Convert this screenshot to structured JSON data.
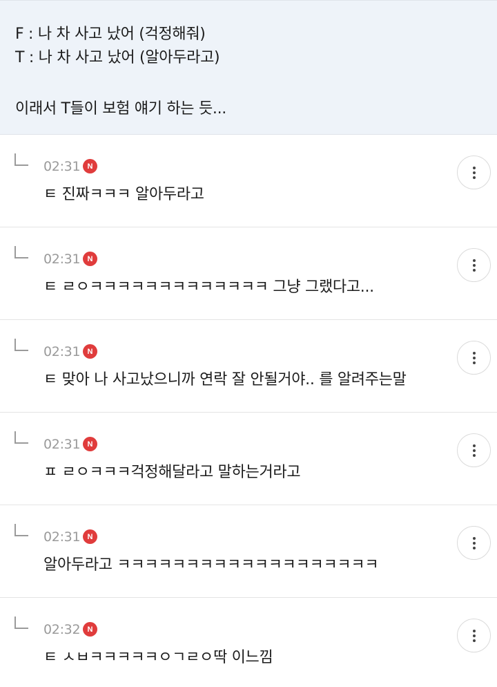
{
  "post": {
    "lines": [
      "F : 나 차 사고 났어 (걱정해줘)",
      "T : 나 차 사고 났어 (알아두라고)",
      "이래서 T들이 보험 얘기 하는 듯..."
    ]
  },
  "comments": [
    {
      "time": "02:31",
      "badge": "N",
      "text": "ㅌ 진짜ㅋㅋㅋ 알아두라고"
    },
    {
      "time": "02:31",
      "badge": "N",
      "text": "ㅌ ㄹㅇㅋㅋㅋㅋㅋㅋㅋㅋㅋㅋㅋㅋㅋ 그냥 그랬다고..."
    },
    {
      "time": "02:31",
      "badge": "N",
      "text": "ㅌ 맞아 나 사고났으니까 연락 잘 안될거야.. 를 알려주는말"
    },
    {
      "time": "02:31",
      "badge": "N",
      "text": "ㅍ ㄹㅇㅋㅋㅋ걱정해달라고 말하는거라고"
    },
    {
      "time": "02:31",
      "badge": "N",
      "text": "알아두라고 ㅋㅋㅋㅋㅋㅋㅋㅋㅋㅋㅋㅋㅋㅋㅋㅋㅋㅋㅋ"
    },
    {
      "time": "02:32",
      "badge": "N",
      "text": "ㅌ ㅅㅂㅋㅋㅋㅋㅋㅇㄱㄹㅇ딱 이느낌"
    }
  ],
  "icons": {
    "reply": "reply-arrow-icon",
    "new": "new-badge-icon",
    "more": "more-vertical-icon"
  },
  "colors": {
    "post_background": "#eef3f9",
    "badge": "#e03c3c",
    "timestamp": "#9a9a9a"
  }
}
